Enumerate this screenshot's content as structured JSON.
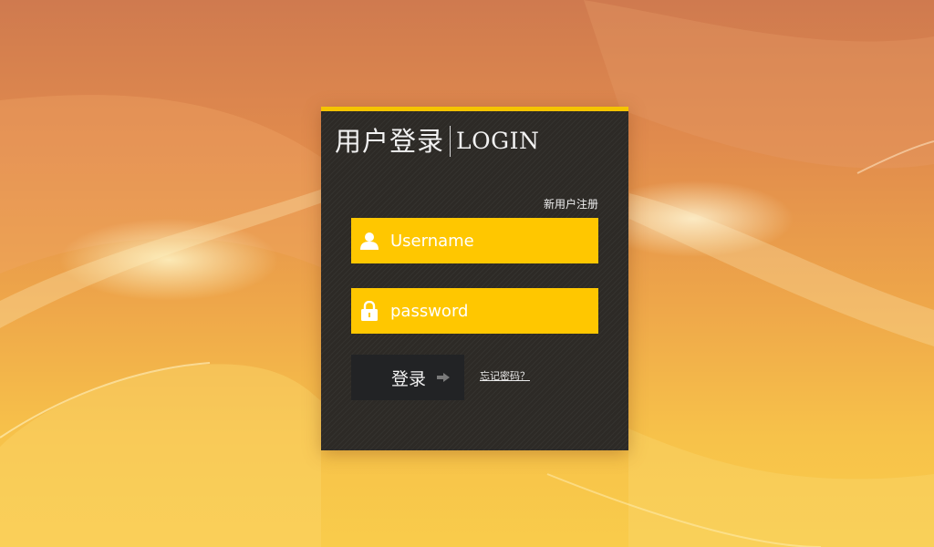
{
  "colors": {
    "accent": "#ffc700",
    "panel_background": "#2d2a26",
    "button_background": "#222325"
  },
  "login": {
    "title_cn": "用户登录",
    "title_en": "LOGIN",
    "register_link": "新用户注册",
    "username": {
      "placeholder": "Username",
      "value": "",
      "icon": "user-icon"
    },
    "password": {
      "placeholder": "password",
      "value": "",
      "icon": "lock-icon"
    },
    "submit_label": "登录",
    "submit_icon": "arrow-right-icon",
    "forgot_link": "忘记密码？"
  }
}
